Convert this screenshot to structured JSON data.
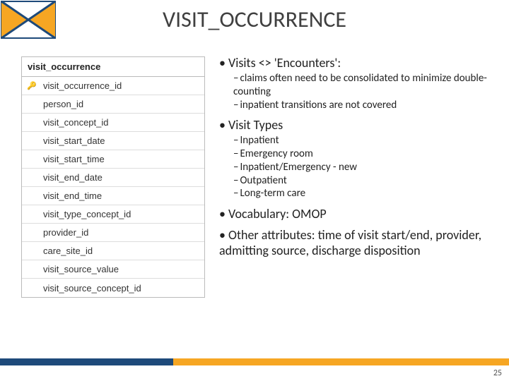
{
  "title": "VISIT_OCCURRENCE",
  "table": {
    "name": "visit_occurrence",
    "columns": [
      {
        "key": true,
        "name": "visit_occurrence_id"
      },
      {
        "key": false,
        "name": "person_id"
      },
      {
        "key": false,
        "name": "visit_concept_id"
      },
      {
        "key": false,
        "name": "visit_start_date"
      },
      {
        "key": false,
        "name": "visit_start_time"
      },
      {
        "key": false,
        "name": "visit_end_date"
      },
      {
        "key": false,
        "name": "visit_end_time"
      },
      {
        "key": false,
        "name": "visit_type_concept_id"
      },
      {
        "key": false,
        "name": "provider_id"
      },
      {
        "key": false,
        "name": "care_site_id"
      },
      {
        "key": false,
        "name": "visit_source_value"
      },
      {
        "key": false,
        "name": "visit_source_concept_id"
      }
    ]
  },
  "bullets": {
    "visits_header": "Visits <> 'Encounters':",
    "visits_sub": [
      "claims often need to be consolidated to minimize double-counting",
      "inpatient transitions are not covered"
    ],
    "types_header": "Visit Types",
    "types_sub": [
      "Inpatient",
      "Emergency room",
      "Inpatient/Emergency - new",
      "Outpatient",
      "Long-term care"
    ],
    "vocab": "Vocabulary: OMOP",
    "other": "Other attributes: time of visit start/end, provider, admitting source, discharge disposition"
  },
  "page_number": "25"
}
